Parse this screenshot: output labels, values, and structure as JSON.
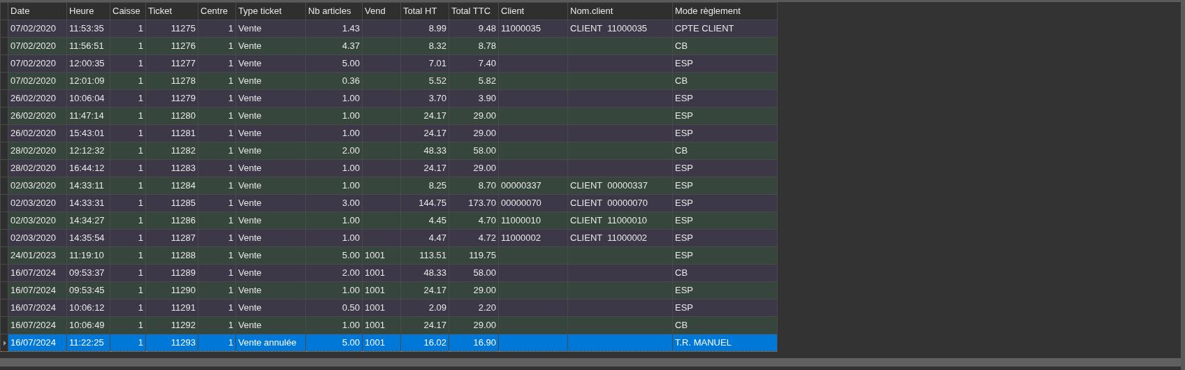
{
  "table": {
    "columns": [
      "Date",
      "Heure",
      "Caisse",
      "Ticket",
      "Centre",
      "Type ticket",
      "Nb articles",
      "Vend",
      "Total HT",
      "Total TTC",
      "Client",
      "Nom.client",
      "Mode règlement"
    ],
    "rows": [
      {
        "date": "07/02/2020",
        "heure": "11:53:35",
        "caisse": "1",
        "ticket": "11275",
        "centre": "1",
        "type_ticket": "Vente",
        "nb_articles": "1.43",
        "total_ht": "8.99",
        "total_ttc": "9.48",
        "client": "11000035",
        "nom_client": "CLIENT  11000035",
        "mode_reglement": "CPTE CLIENT",
        "selected": false
      },
      {
        "date": "07/02/2020",
        "heure": "11:56:51",
        "caisse": "1",
        "ticket": "11276",
        "centre": "1",
        "type_ticket": "Vente",
        "nb_articles": "4.37",
        "total_ht": "8.32",
        "total_ttc": "8.78",
        "mode_reglement": "CB",
        "selected": false
      },
      {
        "date": "07/02/2020",
        "heure": "12:00:35",
        "caisse": "1",
        "ticket": "11277",
        "centre": "1",
        "type_ticket": "Vente",
        "nb_articles": "5.00",
        "total_ht": "7.01",
        "total_ttc": "7.40",
        "mode_reglement": "ESP",
        "selected": false
      },
      {
        "date": "07/02/2020",
        "heure": "12:01:09",
        "caisse": "1",
        "ticket": "11278",
        "centre": "1",
        "type_ticket": "Vente",
        "nb_articles": "0.36",
        "total_ht": "5.52",
        "total_ttc": "5.82",
        "mode_reglement": "CB",
        "selected": false
      },
      {
        "date": "26/02/2020",
        "heure": "10:06:04",
        "caisse": "1",
        "ticket": "11279",
        "centre": "1",
        "type_ticket": "Vente",
        "nb_articles": "1.00",
        "total_ht": "3.70",
        "total_ttc": "3.90",
        "mode_reglement": "ESP",
        "selected": false
      },
      {
        "date": "26/02/2020",
        "heure": "11:47:14",
        "caisse": "1",
        "ticket": "11280",
        "centre": "1",
        "type_ticket": "Vente",
        "nb_articles": "1.00",
        "total_ht": "24.17",
        "total_ttc": "29.00",
        "mode_reglement": "ESP",
        "selected": false
      },
      {
        "date": "26/02/2020",
        "heure": "15:43:01",
        "caisse": "1",
        "ticket": "11281",
        "centre": "1",
        "type_ticket": "Vente",
        "nb_articles": "1.00",
        "total_ht": "24.17",
        "total_ttc": "29.00",
        "mode_reglement": "ESP",
        "selected": false
      },
      {
        "date": "28/02/2020",
        "heure": "12:12:32",
        "caisse": "1",
        "ticket": "11282",
        "centre": "1",
        "type_ticket": "Vente",
        "nb_articles": "2.00",
        "total_ht": "48.33",
        "total_ttc": "58.00",
        "mode_reglement": "CB",
        "selected": false
      },
      {
        "date": "28/02/2020",
        "heure": "16:44:12",
        "caisse": "1",
        "ticket": "11283",
        "centre": "1",
        "type_ticket": "Vente",
        "nb_articles": "1.00",
        "total_ht": "24.17",
        "total_ttc": "29.00",
        "mode_reglement": "ESP",
        "selected": false
      },
      {
        "date": "02/03/2020",
        "heure": "14:33:11",
        "caisse": "1",
        "ticket": "11284",
        "centre": "1",
        "type_ticket": "Vente",
        "nb_articles": "1.00",
        "total_ht": "8.25",
        "total_ttc": "8.70",
        "client": "00000337",
        "nom_client": "CLIENT  00000337",
        "mode_reglement": "ESP",
        "selected": false
      },
      {
        "date": "02/03/2020",
        "heure": "14:33:31",
        "caisse": "1",
        "ticket": "11285",
        "centre": "1",
        "type_ticket": "Vente",
        "nb_articles": "3.00",
        "total_ht": "144.75",
        "total_ttc": "173.70",
        "client": "00000070",
        "nom_client": "CLIENT  00000070",
        "mode_reglement": "ESP",
        "selected": false
      },
      {
        "date": "02/03/2020",
        "heure": "14:34:27",
        "caisse": "1",
        "ticket": "11286",
        "centre": "1",
        "type_ticket": "Vente",
        "nb_articles": "1.00",
        "total_ht": "4.45",
        "total_ttc": "4.70",
        "client": "11000010",
        "nom_client": "CLIENT  11000010",
        "mode_reglement": "ESP",
        "selected": false
      },
      {
        "date": "02/03/2020",
        "heure": "14:35:54",
        "caisse": "1",
        "ticket": "11287",
        "centre": "1",
        "type_ticket": "Vente",
        "nb_articles": "1.00",
        "total_ht": "4.47",
        "total_ttc": "4.72",
        "client": "11000002",
        "nom_client": "CLIENT  11000002",
        "mode_reglement": "ESP",
        "selected": false
      },
      {
        "date": "24/01/2023",
        "heure": "11:19:10",
        "caisse": "1",
        "ticket": "11288",
        "centre": "1",
        "type_ticket": "Vente",
        "nb_articles": "5.00",
        "vend": "1001",
        "total_ht": "113.51",
        "total_ttc": "119.75",
        "mode_reglement": "ESP",
        "selected": false
      },
      {
        "date": "16/07/2024",
        "heure": "09:53:37",
        "caisse": "1",
        "ticket": "11289",
        "centre": "1",
        "type_ticket": "Vente",
        "nb_articles": "2.00",
        "vend": "1001",
        "total_ht": "48.33",
        "total_ttc": "58.00",
        "mode_reglement": "CB",
        "selected": false
      },
      {
        "date": "16/07/2024",
        "heure": "09:53:45",
        "caisse": "1",
        "ticket": "11290",
        "centre": "1",
        "type_ticket": "Vente",
        "nb_articles": "1.00",
        "vend": "1001",
        "total_ht": "24.17",
        "total_ttc": "29.00",
        "mode_reglement": "ESP",
        "selected": false
      },
      {
        "date": "16/07/2024",
        "heure": "10:06:12",
        "caisse": "1",
        "ticket": "11291",
        "centre": "1",
        "type_ticket": "Vente",
        "nb_articles": "0.50",
        "vend": "1001",
        "total_ht": "2.09",
        "total_ttc": "2.20",
        "mode_reglement": "ESP",
        "selected": false
      },
      {
        "date": "16/07/2024",
        "heure": "10:06:49",
        "caisse": "1",
        "ticket": "11292",
        "centre": "1",
        "type_ticket": "Vente",
        "nb_articles": "1.00",
        "vend": "1001",
        "total_ht": "24.17",
        "total_ttc": "29.00",
        "mode_reglement": "CB",
        "selected": false
      },
      {
        "date": "16/07/2024",
        "heure": "11:22:25",
        "caisse": "1",
        "ticket": "11293",
        "centre": "1",
        "type_ticket": "Vente annulée",
        "nb_articles": "5.00",
        "vend": "1001",
        "total_ht": "16.02",
        "total_ttc": "16.90",
        "mode_reglement": "T.R. MANUEL",
        "selected": true
      }
    ]
  }
}
